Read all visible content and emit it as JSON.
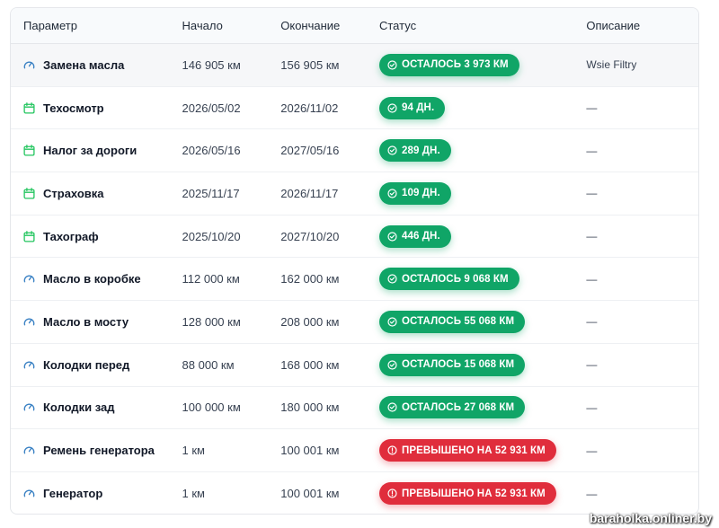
{
  "header": {
    "param": "Параметр",
    "start": "Начало",
    "end": "Окончание",
    "status": "Статус",
    "desc": "Описание"
  },
  "rows": [
    {
      "name": "Замена масла",
      "icon": "gauge-icon",
      "start": "146 905 км",
      "end": "156 905 км",
      "status": "ОСТАЛОСЬ 3 973 КМ",
      "state": "ok",
      "desc": "Wsie Filtry"
    },
    {
      "name": "Техосмотр",
      "icon": "calendar-icon",
      "start": "2026/05/02",
      "end": "2026/11/02",
      "status": "94 ДН.",
      "state": "ok",
      "desc": "—"
    },
    {
      "name": "Налог за дороги",
      "icon": "calendar-icon",
      "start": "2026/05/16",
      "end": "2027/05/16",
      "status": "289 ДН.",
      "state": "ok",
      "desc": "—"
    },
    {
      "name": "Страховка",
      "icon": "calendar-icon",
      "start": "2025/11/17",
      "end": "2026/11/17",
      "status": "109 ДН.",
      "state": "ok",
      "desc": "—"
    },
    {
      "name": "Тахограф",
      "icon": "calendar-icon",
      "start": "2025/10/20",
      "end": "2027/10/20",
      "status": "446 ДН.",
      "state": "ok",
      "desc": "—"
    },
    {
      "name": "Масло в коробке",
      "icon": "gauge-icon",
      "start": "112 000 км",
      "end": "162 000 км",
      "status": "ОСТАЛОСЬ 9 068 КМ",
      "state": "ok",
      "desc": "—"
    },
    {
      "name": "Масло в мосту",
      "icon": "gauge-icon",
      "start": "128 000 км",
      "end": "208 000 км",
      "status": "ОСТАЛОСЬ 55 068 КМ",
      "state": "ok",
      "desc": "—"
    },
    {
      "name": "Колодки перед",
      "icon": "gauge-icon",
      "start": "88 000 км",
      "end": "168 000 км",
      "status": "ОСТАЛОСЬ 15 068 КМ",
      "state": "ok",
      "desc": "—"
    },
    {
      "name": "Колодки зад",
      "icon": "gauge-icon",
      "start": "100 000 км",
      "end": "180 000 км",
      "status": "ОСТАЛОСЬ 27 068 КМ",
      "state": "ok",
      "desc": "—"
    },
    {
      "name": "Ремень генератора",
      "icon": "gauge-icon",
      "start": "1 км",
      "end": "100 001 км",
      "status": "ПРЕВЫШЕНО НА 52 931 КМ",
      "state": "bad",
      "desc": "—"
    },
    {
      "name": "Генератор",
      "icon": "gauge-icon",
      "start": "1 км",
      "end": "100 001 км",
      "status": "ПРЕВЫШЕНО НА 52 931 КМ",
      "state": "bad",
      "desc": "—"
    }
  ],
  "colors": {
    "ok": "#10a567",
    "bad": "#e02d3c",
    "gauge_icon": "#3b82c4",
    "calendar_icon": "#22c55e"
  },
  "watermark": "baraholka.onliner.by"
}
